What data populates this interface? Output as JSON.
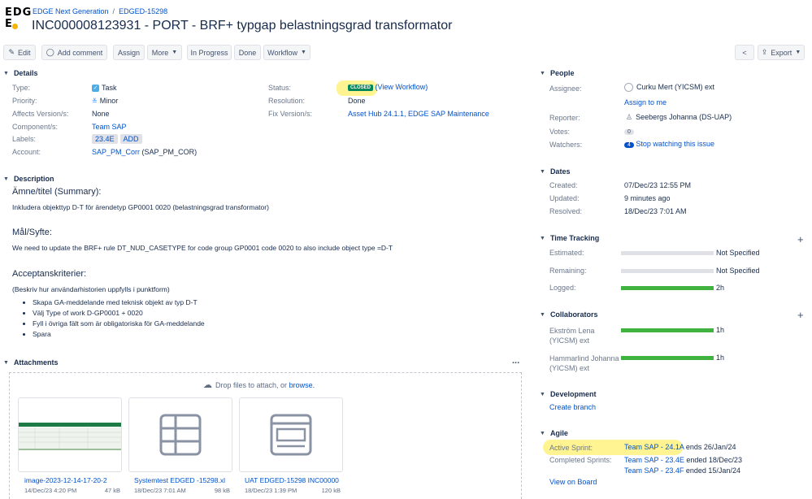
{
  "header": {
    "logo_line1": "EDG",
    "logo_line2": "E",
    "project": "EDGE Next Generation",
    "issue_key": "EDGED-15298",
    "breadcrumb_sep": "/",
    "title": "INC000008123931 - PORT - BRF+ typgap belastningsgrad transformator"
  },
  "toolbar": {
    "edit": "Edit",
    "add_comment": "Add comment",
    "assign": "Assign",
    "more": "More",
    "in_progress": "In Progress",
    "done": "Done",
    "workflow": "Workflow",
    "export": "Export"
  },
  "details": {
    "heading": "Details",
    "type_label": "Type:",
    "type_value": "Task",
    "priority_label": "Priority:",
    "priority_value": "Minor",
    "affects_label": "Affects Version/s:",
    "affects_value": "None",
    "components_label": "Component/s:",
    "components_value": "Team SAP",
    "labels_label": "Labels:",
    "labels_values": [
      "23.4E",
      "ADD"
    ],
    "account_label": "Account:",
    "account_link": "SAP_PM_Corr",
    "account_extra": "(SAP_PM_COR)",
    "status_label": "Status:",
    "status_value": "CLOSED",
    "status_link": "(View Workflow)",
    "resolution_label": "Resolution:",
    "resolution_value": "Done",
    "fix_label": "Fix Version/s:",
    "fix_value": "Asset Hub 24.1.1, EDGE SAP Maintenance"
  },
  "description": {
    "heading": "Description",
    "h1": "Ämne/titel (Summary):",
    "p1": "Inkludera objekttyp D-T för ärendetyp GP0001 0020 (belastningsgrad transformator)",
    "h2": "Mål/Syfte:",
    "p2": "We need to update the BRF+ rule DT_NUD_CASETYPE for code group GP0001 code 0020 to also include object type =D-T",
    "h3": "Acceptanskriterier:",
    "p3": "(Beskriv hur användarhistorien uppfylls i punktform)",
    "bullets": [
      "Skapa GA-meddelande med teknisk objekt av typ D-T",
      "Välj Type of work D-GP0001 + 0020",
      "Fyll i övriga fält som är obligatoriska för GA-meddelande",
      "Spara"
    ]
  },
  "attachments": {
    "heading": "Attachments",
    "more": "...",
    "drop_text": "Drop files to attach, or",
    "browse": "browse.",
    "files": [
      {
        "name": "image-2023-12-14-17-20-2",
        "date": "14/Dec/23 4:20 PM",
        "size": "47 kB"
      },
      {
        "name": "Systemtest EDGED -15298.xl",
        "date": "18/Dec/23 7:01 AM",
        "size": "98 kB"
      },
      {
        "name": "UAT EDGED-15298 INC00000",
        "date": "18/Dec/23 1:39 PM",
        "size": "120 kB"
      }
    ]
  },
  "people": {
    "heading": "People",
    "assignee_label": "Assignee:",
    "assignee_value": "Curku Mert (YICSM) ext",
    "assign_to_me": "Assign to me",
    "reporter_label": "Reporter:",
    "reporter_value": "Seebergs Johanna (DS-UAP)",
    "votes_label": "Votes:",
    "votes_value": "0",
    "watchers_label": "Watchers:",
    "watchers_count": "4",
    "watchers_link": "Stop watching this issue"
  },
  "dates": {
    "heading": "Dates",
    "created_label": "Created:",
    "created_value": "07/Dec/23 12:55 PM",
    "updated_label": "Updated:",
    "updated_value": "9 minutes ago",
    "resolved_label": "Resolved:",
    "resolved_value": "18/Dec/23 7:01 AM"
  },
  "time_tracking": {
    "heading": "Time Tracking",
    "estimated_label": "Estimated:",
    "estimated_value": "Not Specified",
    "remaining_label": "Remaining:",
    "remaining_value": "Not Specified",
    "logged_label": "Logged:",
    "logged_value": "2h",
    "logged_fraction": 1.0
  },
  "collaborators": {
    "heading": "Collaborators",
    "items": [
      {
        "name_l1": "Ekström Lena",
        "name_l2": "(YICSM) ext",
        "value": "1h",
        "fraction": 1.0
      },
      {
        "name_l1": "Hammarlind Johanna",
        "name_l2": "(YICSM) ext",
        "value": "1h",
        "fraction": 1.0
      }
    ]
  },
  "development": {
    "heading": "Development",
    "create_branch": "Create branch"
  },
  "agile": {
    "heading": "Agile",
    "active_label": "Active Sprint:",
    "active_sprint": "Team SAP - 24.1A",
    "active_ends": "ends 26/Jan/24",
    "completed_label": "Completed Sprints:",
    "completed": [
      {
        "sprint": "Team SAP - 23.4E",
        "ended": "ended 18/Dec/23"
      },
      {
        "sprint": "Team SAP - 23.4F",
        "ended": "ended 15/Jan/24"
      }
    ],
    "view_on_board": "View on Board"
  }
}
